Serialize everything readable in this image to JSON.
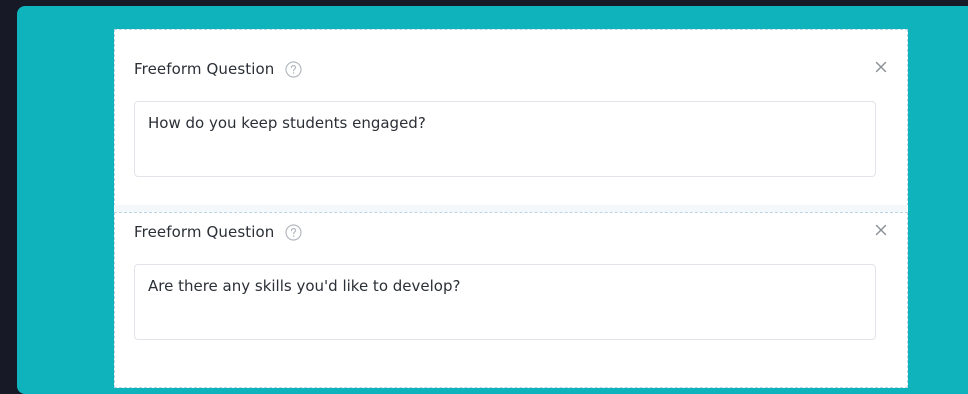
{
  "questions": [
    {
      "title": "Freeform Question",
      "help_icon": "help-circle-icon",
      "close_icon": "close-icon",
      "value": "How do you keep students engaged?"
    },
    {
      "title": "Freeform Question",
      "help_icon": "help-circle-icon",
      "close_icon": "close-icon",
      "value": "Are there any skills you'd like to develop?"
    }
  ],
  "colors": {
    "page_background": "#171a26",
    "panel_background": "#0fb3bb",
    "card_border": "#b8d4e6",
    "text": "#2b2f36"
  }
}
